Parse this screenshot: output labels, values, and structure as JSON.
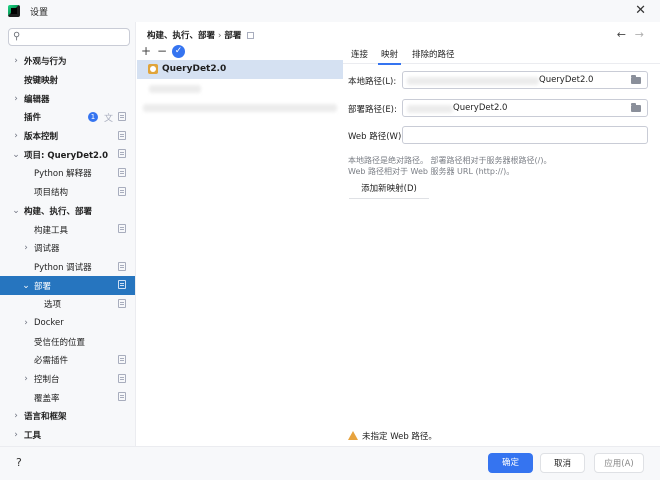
{
  "window": {
    "title": "设置"
  },
  "sidebar": {
    "search_placeholder": "",
    "items": [
      {
        "label": "外观与行为",
        "chevron": "›",
        "indent": 0,
        "bold": true,
        "cfg": false,
        "selected": false
      },
      {
        "label": "按键映射",
        "chevron": "",
        "indent": 0,
        "bold": true,
        "cfg": false,
        "selected": false
      },
      {
        "label": "编辑器",
        "chevron": "›",
        "indent": 0,
        "bold": true,
        "cfg": false,
        "selected": false
      },
      {
        "label": "插件",
        "chevron": "",
        "indent": 0,
        "bold": true,
        "cfg": true,
        "selected": false,
        "badge": "1"
      },
      {
        "label": "版本控制",
        "chevron": "›",
        "indent": 0,
        "bold": true,
        "cfg": true,
        "selected": false
      },
      {
        "label": "项目: QueryDet2.0",
        "chevron": "⌄",
        "indent": 0,
        "bold": true,
        "cfg": true,
        "selected": false
      },
      {
        "label": "Python 解释器",
        "chevron": "",
        "indent": 1,
        "bold": false,
        "cfg": true,
        "selected": false
      },
      {
        "label": "项目结构",
        "chevron": "",
        "indent": 1,
        "bold": false,
        "cfg": true,
        "selected": false
      },
      {
        "label": "构建、执行、部署",
        "chevron": "⌄",
        "indent": 0,
        "bold": true,
        "cfg": false,
        "selected": false
      },
      {
        "label": "构建工具",
        "chevron": "",
        "indent": 1,
        "bold": false,
        "cfg": true,
        "selected": false
      },
      {
        "label": "调试器",
        "chevron": "›",
        "indent": 1,
        "bold": false,
        "cfg": false,
        "selected": false
      },
      {
        "label": "Python 调试器",
        "chevron": "",
        "indent": 1,
        "bold": false,
        "cfg": true,
        "selected": false
      },
      {
        "label": "部署",
        "chevron": "⌄",
        "indent": 1,
        "bold": false,
        "cfg": true,
        "selected": true
      },
      {
        "label": "选项",
        "chevron": "",
        "indent": 2,
        "bold": false,
        "cfg": true,
        "selected": false
      },
      {
        "label": "Docker",
        "chevron": "›",
        "indent": 1,
        "bold": false,
        "cfg": false,
        "selected": false
      },
      {
        "label": "受信任的位置",
        "chevron": "",
        "indent": 1,
        "bold": false,
        "cfg": false,
        "selected": false
      },
      {
        "label": "必需插件",
        "chevron": "",
        "indent": 1,
        "bold": false,
        "cfg": true,
        "selected": false
      },
      {
        "label": "控制台",
        "chevron": "›",
        "indent": 1,
        "bold": false,
        "cfg": true,
        "selected": false
      },
      {
        "label": "覆盖率",
        "chevron": "",
        "indent": 1,
        "bold": false,
        "cfg": true,
        "selected": false
      },
      {
        "label": "语言和框架",
        "chevron": "›",
        "indent": 0,
        "bold": true,
        "cfg": false,
        "selected": false
      },
      {
        "label": "工具",
        "chevron": "›",
        "indent": 0,
        "bold": true,
        "cfg": false,
        "selected": false
      }
    ]
  },
  "breadcrumb": {
    "parts": [
      "构建、执行、部署",
      "部署"
    ],
    "separator": "›"
  },
  "toolbar": {
    "add": "+",
    "remove": "−",
    "check": "✓"
  },
  "servers": [
    {
      "name": "QueryDet2.0",
      "selected": true
    }
  ],
  "right": {
    "nav_back": "←",
    "nav_forward": "→",
    "tabs": [
      "连接",
      "映射",
      "排除的路径"
    ],
    "active_tab": 1,
    "local_path_label": "本地路径(L):",
    "local_path_value": "QueryDet2.0",
    "deploy_path_label": "部署路径(E):",
    "deploy_path_value": "QueryDet2.0",
    "web_path_label": "Web 路径(W):",
    "web_path_value": "",
    "hint_line1": "本地路径是绝对路径。 部署路径相对于服务器根路径(/)。",
    "hint_line2": "Web 路径相对于 Web 服务器 URL (http://)。",
    "add_mapping": "添加新映射(D)",
    "warning": "未指定 Web 路径。"
  },
  "footer": {
    "help": "?",
    "ok": "确定",
    "cancel": "取消",
    "apply": "应用(A)"
  },
  "colors": {
    "accent": "#3574f0",
    "selection": "#2675bf",
    "warning": "#e7a33e"
  },
  "icons": [
    "app-icon",
    "close-icon",
    "search-icon",
    "chevron-icon",
    "config-icon",
    "language-icon",
    "add-icon",
    "remove-icon",
    "check-icon",
    "server-icon",
    "folder-icon",
    "back-arrow-icon",
    "forward-arrow-icon",
    "warning-icon",
    "help-icon"
  ]
}
